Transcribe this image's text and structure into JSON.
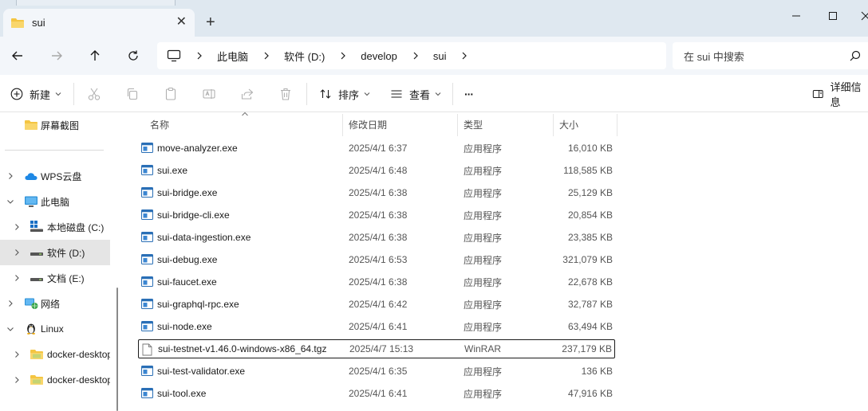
{
  "window": {
    "tab_title": "sui",
    "tab_close": "✕",
    "new_tab": "+"
  },
  "breadcrumb": [
    "此电脑",
    "软件 (D:)",
    "develop",
    "sui"
  ],
  "search": {
    "placeholder": "在 sui 中搜索"
  },
  "toolbar": {
    "new_label": "新建",
    "sort_label": "排序",
    "view_label": "查看",
    "more_label": "···",
    "details_label": "详细信息"
  },
  "sidebar": {
    "items": [
      {
        "label": "屏幕截图",
        "icon": "folder-icon"
      },
      {
        "label": "WPS云盘",
        "icon": "cloud-icon"
      },
      {
        "label": "此电脑",
        "icon": "computer-icon"
      },
      {
        "label": "本地磁盘 (C:)",
        "icon": "windows-drive-icon"
      },
      {
        "label": "软件 (D:)",
        "icon": "drive-icon"
      },
      {
        "label": "文档 (E:)",
        "icon": "drive-icon"
      },
      {
        "label": "网络",
        "icon": "network-icon"
      },
      {
        "label": "Linux",
        "icon": "linux-penguin-icon"
      },
      {
        "label": "docker-desktop",
        "icon": "folder-icon"
      },
      {
        "label": "docker-desktop-data",
        "icon": "folder-icon"
      }
    ]
  },
  "columns": {
    "name": "名称",
    "date": "修改日期",
    "type": "类型",
    "size": "大小"
  },
  "files": [
    {
      "name": "move-analyzer.exe",
      "date": "2025/4/1 6:37",
      "type": "应用程序",
      "size": "16,010 KB",
      "icon": "exe"
    },
    {
      "name": "sui.exe",
      "date": "2025/4/1 6:48",
      "type": "应用程序",
      "size": "118,585 KB",
      "icon": "exe"
    },
    {
      "name": "sui-bridge.exe",
      "date": "2025/4/1 6:38",
      "type": "应用程序",
      "size": "25,129 KB",
      "icon": "exe"
    },
    {
      "name": "sui-bridge-cli.exe",
      "date": "2025/4/1 6:38",
      "type": "应用程序",
      "size": "20,854 KB",
      "icon": "exe"
    },
    {
      "name": "sui-data-ingestion.exe",
      "date": "2025/4/1 6:38",
      "type": "应用程序",
      "size": "23,385 KB",
      "icon": "exe"
    },
    {
      "name": "sui-debug.exe",
      "date": "2025/4/1 6:53",
      "type": "应用程序",
      "size": "321,079 KB",
      "icon": "exe"
    },
    {
      "name": "sui-faucet.exe",
      "date": "2025/4/1 6:38",
      "type": "应用程序",
      "size": "22,678 KB",
      "icon": "exe"
    },
    {
      "name": "sui-graphql-rpc.exe",
      "date": "2025/4/1 6:42",
      "type": "应用程序",
      "size": "32,787 KB",
      "icon": "exe"
    },
    {
      "name": "sui-node.exe",
      "date": "2025/4/1 6:41",
      "type": "应用程序",
      "size": "63,494 KB",
      "icon": "exe"
    },
    {
      "name": "sui-testnet-v1.46.0-windows-x86_64.tgz",
      "date": "2025/4/7 15:13",
      "type": "WinRAR",
      "size": "237,179 KB",
      "icon": "file",
      "selected": true
    },
    {
      "name": "sui-test-validator.exe",
      "date": "2025/4/1 6:35",
      "type": "应用程序",
      "size": "136 KB",
      "icon": "exe"
    },
    {
      "name": "sui-tool.exe",
      "date": "2025/4/1 6:41",
      "type": "应用程序",
      "size": "47,916 KB",
      "icon": "exe"
    }
  ],
  "colors": {
    "folder": "#f4c542",
    "accent": "#0067c0",
    "selection": "#e5e5e5"
  }
}
